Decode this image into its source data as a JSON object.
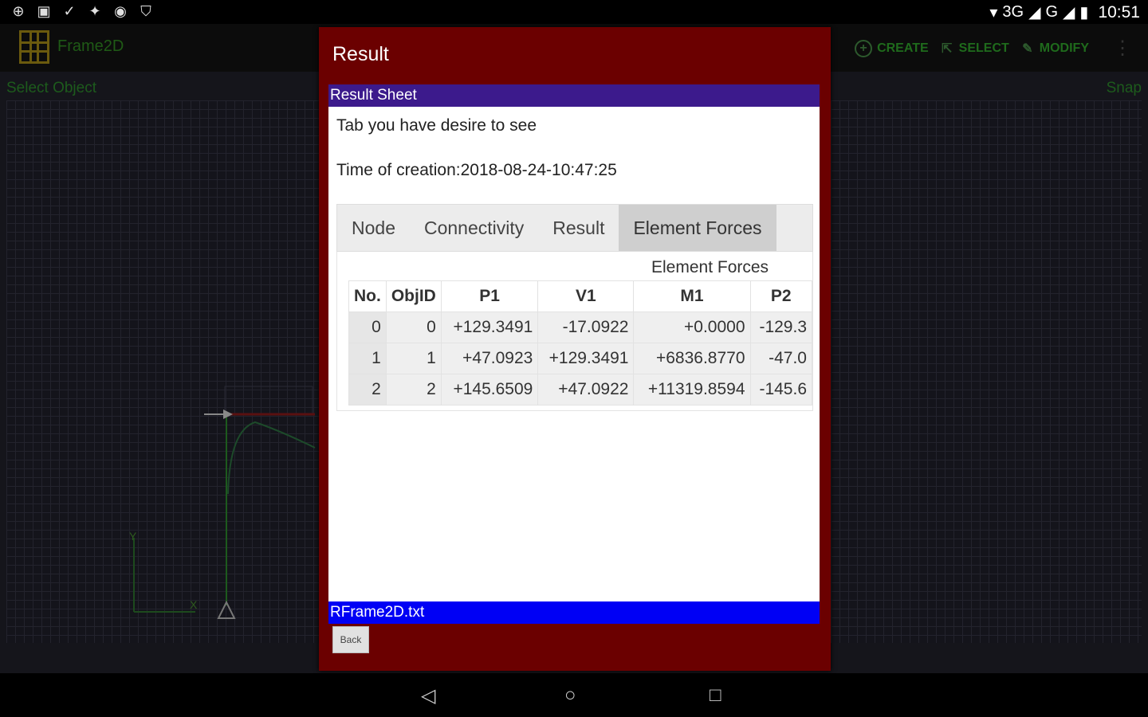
{
  "status_bar": {
    "network": "3G",
    "network2": "G",
    "time": "10:51"
  },
  "app": {
    "title": "Frame2D",
    "actions": [
      {
        "label": "CREATE",
        "icon": "plus-circle-icon"
      },
      {
        "label": "SELECT",
        "icon": "pointer-icon"
      },
      {
        "label": "MODIFY",
        "icon": "pencil-icon"
      }
    ]
  },
  "canvas": {
    "left_label": "Select Object",
    "right_label": "Snap"
  },
  "dialog": {
    "title": "Result",
    "sheet_header": "Result Sheet",
    "intro": "Tab you have desire to see",
    "created": "Time of creation:2018-08-24-10:47:25",
    "tabs": [
      "Node",
      "Connectivity",
      "Result",
      "Element Forces"
    ],
    "active_tab": "Element Forces",
    "panel_title": "Element Forces",
    "table": {
      "headers": [
        "No.",
        "ObjID",
        "P1",
        "V1",
        "M1",
        "P2"
      ],
      "rows": [
        [
          "0",
          "0",
          "+129.3491",
          "-17.0922",
          "+0.0000",
          "-129.3"
        ],
        [
          "1",
          "1",
          "+47.0923",
          "+129.3491",
          "+6836.8770",
          "-47.0"
        ],
        [
          "2",
          "2",
          "+145.6509",
          "+47.0922",
          "+11319.8594",
          "-145.6"
        ]
      ]
    },
    "file_name": "RFrame2D.txt",
    "back_label": "Back"
  },
  "colors": {
    "dialog_bg": "#6b0000",
    "sheet_header_bg": "#3c1a8c",
    "file_bar_bg": "#0000f5",
    "accent_green": "#1f6b1c"
  }
}
